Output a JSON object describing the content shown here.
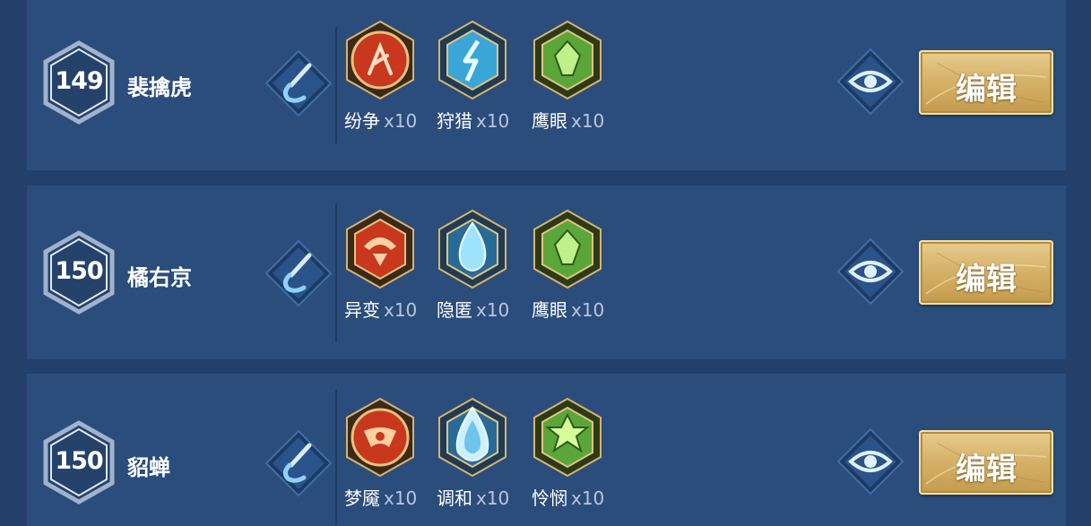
{
  "rows": [
    {
      "level": "149",
      "name": "裴擒虎",
      "runes": [
        {
          "name": "纷争",
          "count": "x10",
          "color": "#c8381f",
          "icon": "red-rune-icon"
        },
        {
          "name": "狩猎",
          "count": "x10",
          "color": "#3aa6d8",
          "icon": "blue-rune-icon"
        },
        {
          "name": "鹰眼",
          "count": "x10",
          "color": "#5aa63a",
          "icon": "green-rune-icon"
        }
      ],
      "edit_label": "编辑"
    },
    {
      "level": "150",
      "name": "橘右京",
      "runes": [
        {
          "name": "异变",
          "count": "x10",
          "color": "#c8381f",
          "icon": "red-rune-icon"
        },
        {
          "name": "隐匿",
          "count": "x10",
          "color": "#3aa6d8",
          "icon": "blue-rune-icon"
        },
        {
          "name": "鹰眼",
          "count": "x10",
          "color": "#5aa63a",
          "icon": "green-rune-icon"
        }
      ],
      "edit_label": "编辑"
    },
    {
      "level": "150",
      "name": "貂蝉",
      "runes": [
        {
          "name": "梦魇",
          "count": "x10",
          "color": "#c8381f",
          "icon": "red-rune-icon"
        },
        {
          "name": "调和",
          "count": "x10",
          "color": "#3aa6d8",
          "icon": "blue-rune-icon"
        },
        {
          "name": "怜悯",
          "count": "x10",
          "color": "#5aa63a",
          "icon": "green-rune-icon"
        }
      ],
      "edit_label": "编辑"
    }
  ]
}
